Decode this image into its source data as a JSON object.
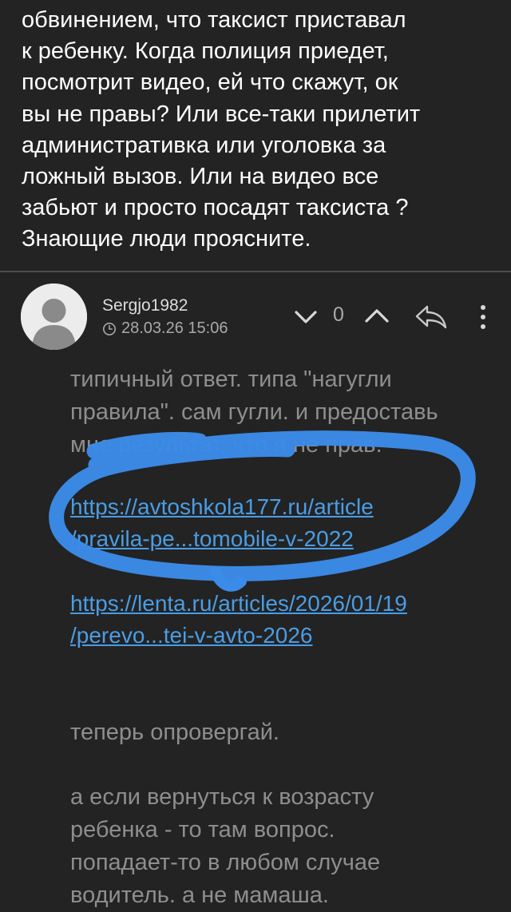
{
  "post": {
    "lines": [
      "обвинением, что таксист приставал",
      "к ребенку. Когда полиция приедет,",
      "посмотрит видео, ей что скажут, ок",
      "вы не правы? Или все-таки прилетит",
      "административка или уголовка за",
      "ложный вызов. Или на видео все",
      "забьют и просто посадят таксиста ?",
      "Знающие люди проясните."
    ]
  },
  "comment": {
    "author": "Sergjo1982",
    "date": "28.03.26 15:06",
    "score": "0",
    "text_lines": [
      "типичный ответ. типа \"нагугли",
      "правила\". сам гугли. и предоставь",
      "мне результат, что я не прав."
    ],
    "link1": {
      "line1": "https://avtoshkola177.ru/article",
      "line2": "/pravila-pe...tomobile-v-2022"
    },
    "link2": {
      "line1": "https://lenta.ru/articles/2026/01/19",
      "line2": "/perevo...tei-v-avto-2026"
    },
    "after_text": "теперь опровергай.",
    "final_lines": [
      "а если вернуться к возрасту",
      "ребенка - то там вопрос.",
      "попадает-то в любом случае",
      "водитель. а не мамаша."
    ]
  },
  "icons": {
    "avatar": "user-silhouette",
    "clock": "clock-icon",
    "downvote": "chevron-down-icon",
    "upvote": "chevron-up-icon",
    "reply": "reply-arrow-icon",
    "more": "more-vertical-icon"
  },
  "colors": {
    "background": "#232323",
    "link": "#4a9de5",
    "highlight_stroke": "#3b8be8"
  }
}
